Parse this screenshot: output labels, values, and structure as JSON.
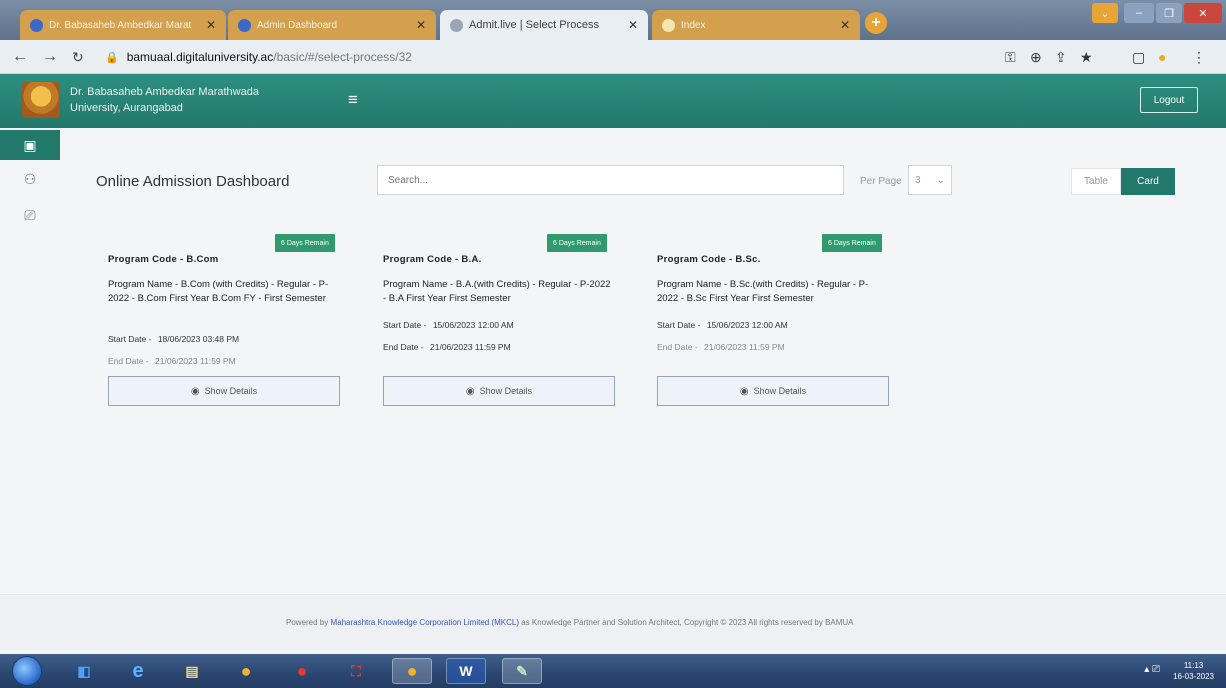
{
  "browser": {
    "tabs": [
      {
        "title": "Dr. Babasaheb Ambedkar Marat",
        "active": false
      },
      {
        "title": "Admin Dashboard",
        "active": false
      },
      {
        "title": "Admit.live | Select Process",
        "active": true
      },
      {
        "title": "Index",
        "active": false
      }
    ],
    "url_host": "bamuaal.digitaluniversity.ac",
    "url_path": "/basic/#/select-process/32"
  },
  "header": {
    "university_line1": "Dr. Babasaheb Ambedkar Marathwada",
    "university_line2": "University, Aurangabad",
    "logout_label": "Logout"
  },
  "main": {
    "title": "Online Admission Dashboard",
    "search_placeholder": "Search...",
    "per_page_label": "Per Page",
    "per_page_value": "3",
    "view_table_label": "Table",
    "view_card_label": "Card"
  },
  "cards": [
    {
      "badge": "6 Days Remain",
      "code_label": "Program Code - ",
      "code": "B.Com",
      "name_label": "Program Name - ",
      "name": "B.Com (with Credits) - Regular - P-2022 - B.Com First Year B.Com FY - First Semester",
      "start_label": "Start Date - ",
      "start": "18/06/2023 03:48 PM",
      "end_label": "End Date - ",
      "end": "21/06/2023 11:59 PM",
      "button": "Show Details"
    },
    {
      "badge": "6 Days Remain",
      "code_label": "Program Code - ",
      "code": "B.A.",
      "name_label": "Program Name - ",
      "name": "B.A.(with Credits) - Regular - P-2022 - B.A First Year First Semester",
      "start_label": "Start Date - ",
      "start": "15/06/2023 12:00 AM",
      "end_label": "End Date - ",
      "end": "21/06/2023 11:59 PM",
      "button": "Show Details"
    },
    {
      "badge": "6 Days Remain",
      "code_label": "Program Code - ",
      "code": "B.Sc.",
      "name_label": "Program Name - ",
      "name": "B.Sc.(with Credits) - Regular - P-2022 - B.Sc First Year First Semester",
      "start_label": "Start Date - ",
      "start": "15/06/2023 12:00 AM",
      "end_label": "End Date - ",
      "end": "21/06/2023 11:59 PM",
      "button": "Show Details"
    }
  ],
  "footer": {
    "prefix": "Powered by ",
    "org": "Maharashtra Knowledge Corporation Limited (MKCL)",
    "suffix": " as Knowledge Partner and Solution Architect, Copyright © 2023 All rights reserved by BAMUA"
  },
  "taskbar": {
    "time": "11:13",
    "date": "16-03-2023"
  },
  "colors": {
    "header": "#23786c",
    "badge": "#2f9a6e",
    "tab_inactive": "#d3a04d",
    "link": "#3a57b5"
  },
  "icons": {
    "sidebar": [
      "briefcase-icon",
      "users-icon",
      "monitor-icon"
    ]
  }
}
